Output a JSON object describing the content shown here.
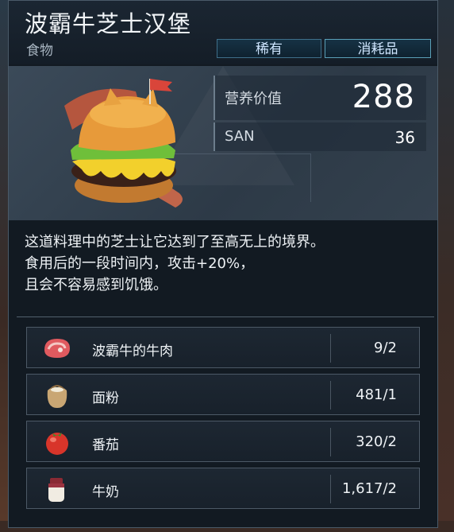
{
  "item": {
    "name": "波霸牛芝士汉堡",
    "category": "食物",
    "tags": {
      "rarity": "稀有",
      "type": "消耗品"
    },
    "stats": {
      "nutrition_label": "营养价值",
      "nutrition_value": "288",
      "san_label": "SAN",
      "san_value": "36"
    },
    "description": [
      "这道料理中的芝士让它达到了至高无上的境界。",
      "食用后的一段时间内，攻击+20%，",
      "且会不容易感到饥饿。"
    ],
    "ingredients": [
      {
        "name": "波霸牛的牛肉",
        "count": "9/2",
        "icon": "beef-icon"
      },
      {
        "name": "面粉",
        "count": "481/1",
        "icon": "flour-sack-icon"
      },
      {
        "name": "番茄",
        "count": "320/2",
        "icon": "tomato-icon"
      },
      {
        "name": "牛奶",
        "count": "1,617/2",
        "icon": "milk-jar-icon"
      }
    ]
  },
  "colors": {
    "panel": "#121a22",
    "info_bg": "#34414e",
    "tag_border": "#5aa0b8"
  }
}
